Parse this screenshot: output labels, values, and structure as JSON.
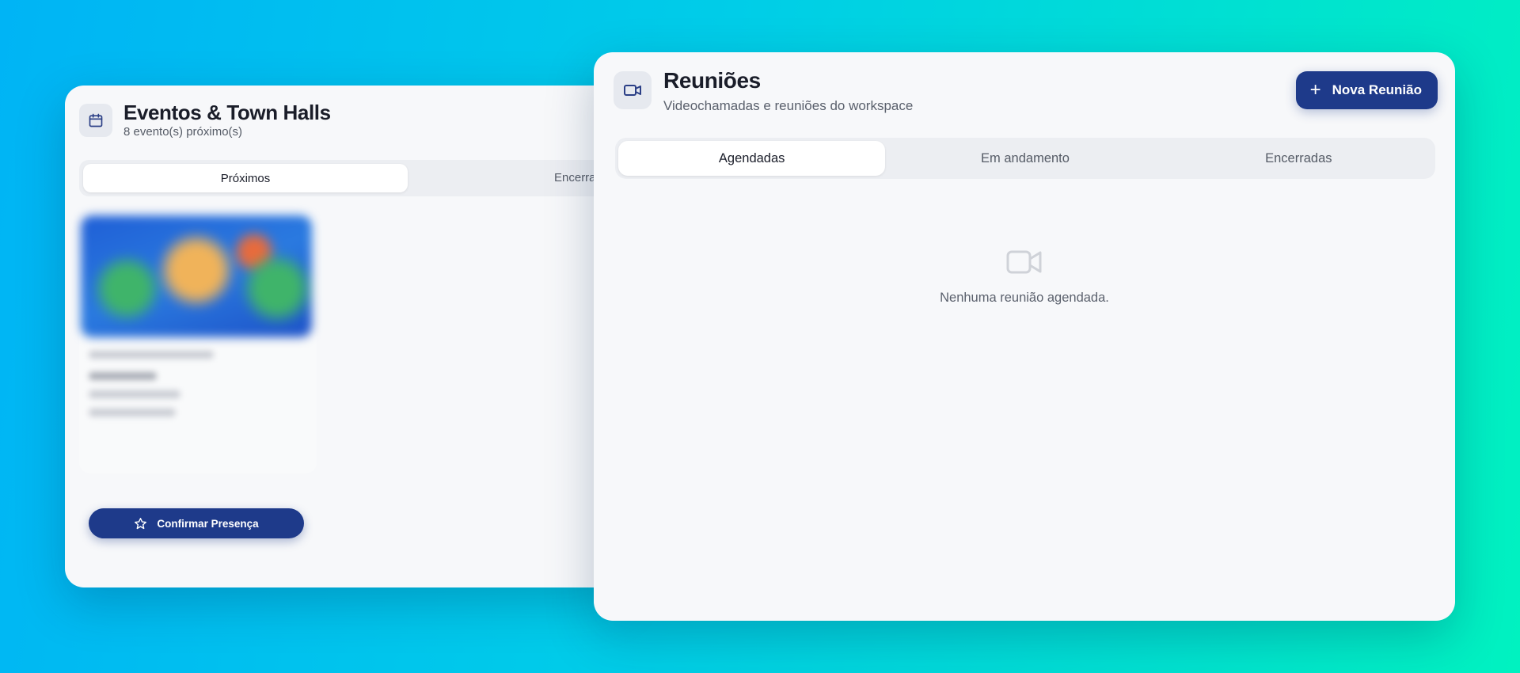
{
  "events_panel": {
    "title": "Eventos & Town Halls",
    "subtitle": "8 evento(s) próximo(s)",
    "tabs": [
      {
        "label": "Próximos",
        "active": true
      },
      {
        "label": "Encerrado"
      }
    ],
    "event_card": {
      "confirm_label": "Confirmar Presença"
    }
  },
  "meetings_panel": {
    "title": "Reuniões",
    "subtitle": "Videochamadas e reuniões do workspace",
    "new_button_label": "Nova Reunião",
    "tabs": [
      {
        "label": "Agendadas",
        "active": true
      },
      {
        "label": "Em andamento"
      },
      {
        "label": "Encerradas"
      }
    ],
    "empty_message": "Nenhuma reunião agendada."
  },
  "colors": {
    "primary": "#1e3a8a",
    "card_bg": "#f7f8fa",
    "background_start": "#00b4f5",
    "background_end": "#00f2c0"
  }
}
